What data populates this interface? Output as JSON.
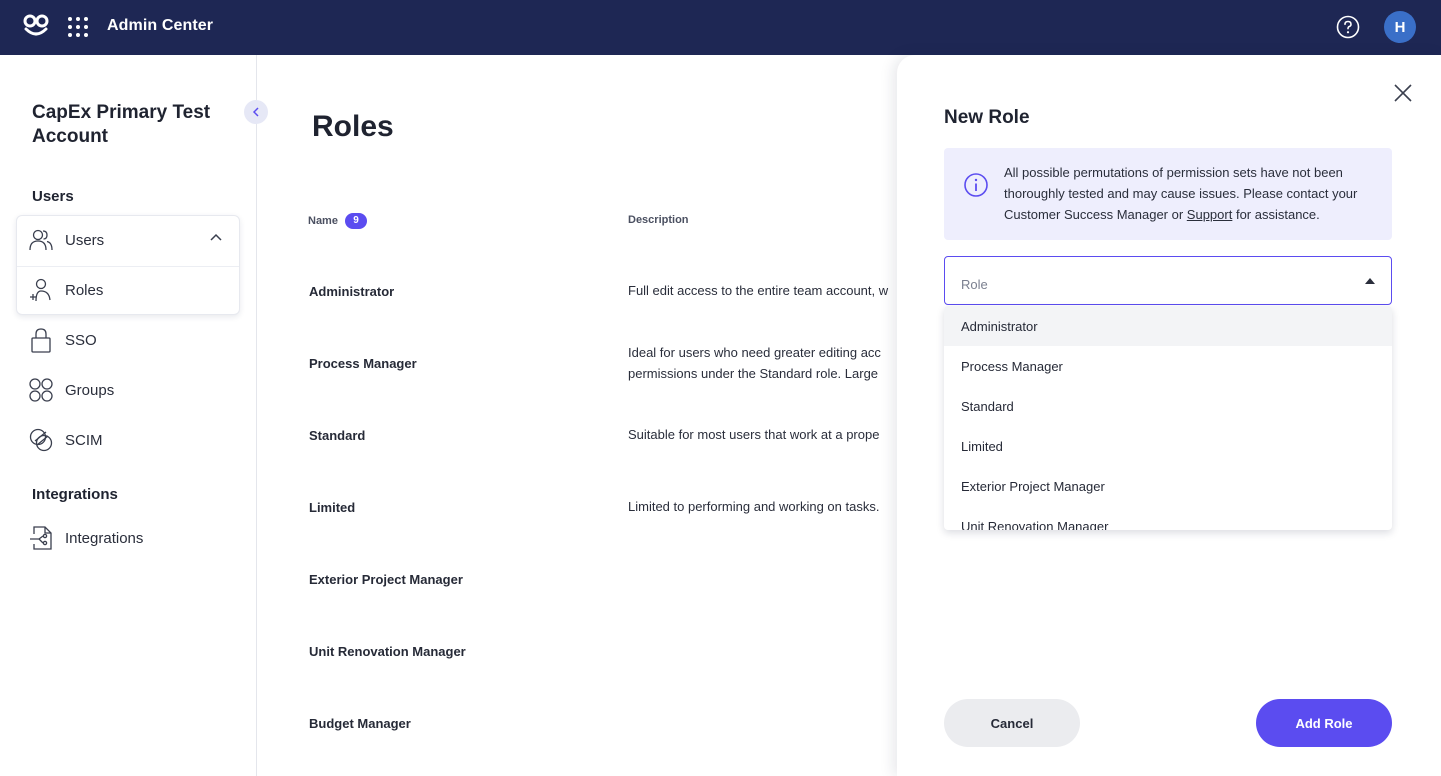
{
  "header": {
    "title": "Admin Center",
    "avatar_initial": "H"
  },
  "sidebar": {
    "account_name": "CapEx Primary Test Account",
    "sections": [
      {
        "heading": "Users"
      },
      {
        "heading": "Integrations"
      }
    ],
    "items": [
      {
        "label": "Users",
        "icon": "users-icon"
      },
      {
        "label": "Roles",
        "icon": "roles-icon"
      },
      {
        "label": "SSO",
        "icon": "lock-icon"
      },
      {
        "label": "Groups",
        "icon": "groups-icon"
      },
      {
        "label": "SCIM",
        "icon": "scim-icon"
      },
      {
        "label": "Integrations",
        "icon": "integrations-icon"
      }
    ]
  },
  "main": {
    "title": "Roles",
    "columns": {
      "name": "Name",
      "count": "9",
      "description": "Description"
    },
    "rows": [
      {
        "name": "Administrator",
        "description": "Full edit access to the entire team account, w"
      },
      {
        "name": "Process Manager",
        "description": "Ideal for users who need greater editing acc",
        "description2": "permissions under the Standard role. Large"
      },
      {
        "name": "Standard",
        "description": "Suitable for most users that work at a prope"
      },
      {
        "name": "Limited",
        "description": "Limited to performing and working on tasks."
      },
      {
        "name": "Exterior Project Manager",
        "description": ""
      },
      {
        "name": "Unit Renovation Manager",
        "description": ""
      },
      {
        "name": "Budget Manager",
        "description": ""
      }
    ]
  },
  "drawer": {
    "title": "New Role",
    "info": {
      "text_before": "All possible permutations of permission sets have not been thoroughly tested and may cause issues. Please contact your Customer Success Manager or ",
      "link": "Support",
      "text_after": " for assistance."
    },
    "select": {
      "placeholder": "Role"
    },
    "options": [
      "Administrator",
      "Process Manager",
      "Standard",
      "Limited",
      "Exterior Project Manager",
      "Unit Renovation Manager"
    ],
    "cancel_label": "Cancel",
    "add_label": "Add Role"
  },
  "colors": {
    "topbar": "#1e2754",
    "accent": "#5b4cf0",
    "info_bg": "#eeeefd"
  }
}
